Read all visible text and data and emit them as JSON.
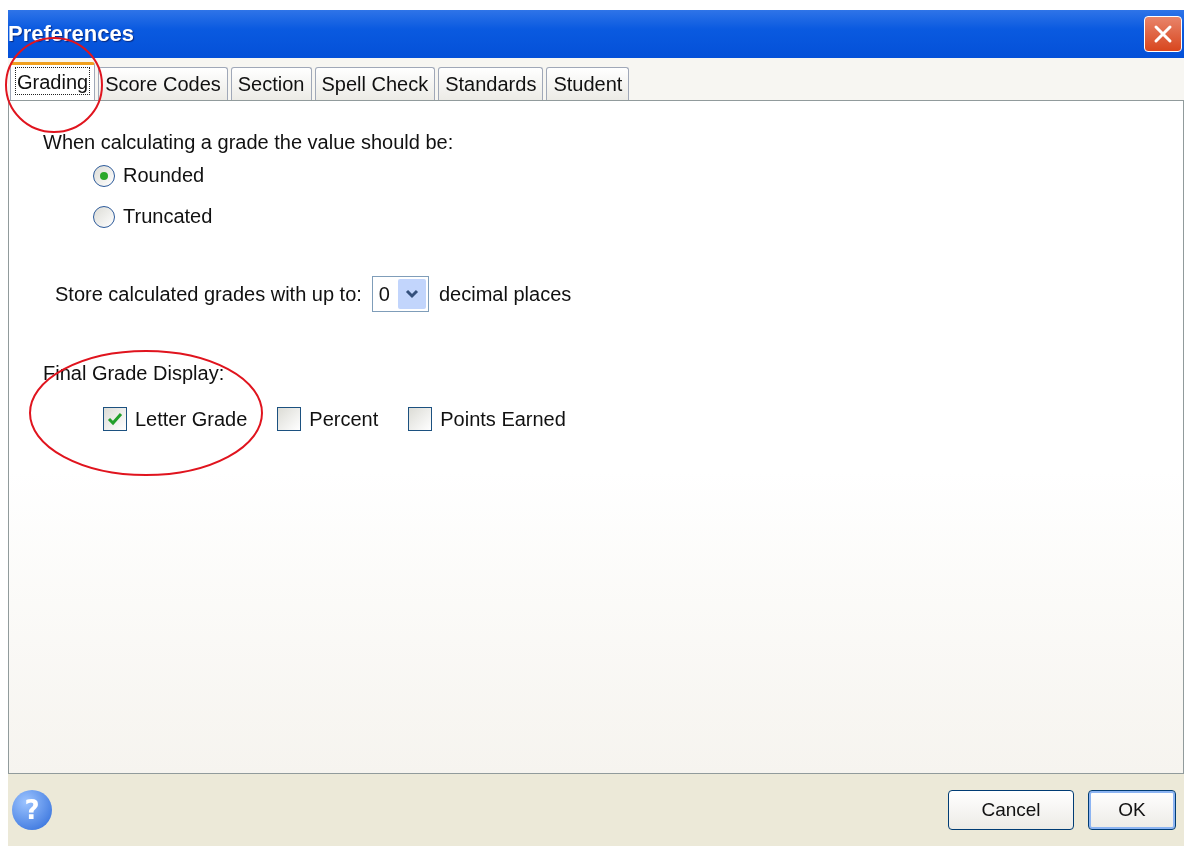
{
  "window": {
    "title": "Preferences"
  },
  "tabs": [
    {
      "label": "Grading",
      "selected": true
    },
    {
      "label": "Score Codes",
      "selected": false
    },
    {
      "label": "Section",
      "selected": false
    },
    {
      "label": "Spell Check",
      "selected": false
    },
    {
      "label": "Standards",
      "selected": false
    },
    {
      "label": "Student",
      "selected": false
    }
  ],
  "rounding": {
    "label": "When calculating a grade the value should be:",
    "options": [
      {
        "label": "Rounded",
        "selected": true
      },
      {
        "label": "Truncated",
        "selected": false
      }
    ]
  },
  "decimals": {
    "label_before": "Store calculated grades with up to:",
    "value": "0",
    "label_after": "decimal places"
  },
  "final_grade_display": {
    "label": "Final Grade Display:",
    "options": [
      {
        "label": "Letter Grade",
        "checked": true
      },
      {
        "label": "Percent",
        "checked": false
      },
      {
        "label": "Points Earned",
        "checked": false
      }
    ]
  },
  "annotations": [
    {
      "kind": "ellipse",
      "color": "#e0141e"
    },
    {
      "kind": "ellipse",
      "color": "#e0141e"
    }
  ],
  "footer": {
    "help": "?",
    "buttons": [
      {
        "label": "Cancel",
        "default": false
      },
      {
        "label": "OK",
        "default": true
      }
    ]
  }
}
